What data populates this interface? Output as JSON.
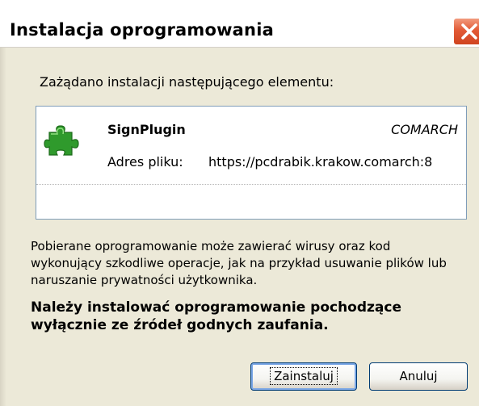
{
  "window": {
    "title": "Instalacja oprogramowania"
  },
  "dialog": {
    "request_text": "Zażądano instalacji następującego elementu:",
    "item": {
      "name": "SignPlugin",
      "vendor": "COMARCH",
      "address_label": "Adres pliku:",
      "address_value": "https://pcdrabik.krakow.comarch:8",
      "icon": "green-puzzle-piece-icon"
    },
    "warning_text": "Pobierane oprogramowanie może zawierać wirusy oraz kod wykonujący szkodliwe operacje, jak na przykład usuwanie plików lub naruszanie prywatności użytkownika.",
    "bold_warning_text": "Należy instalować oprogramowanie pochodzące wyłącznie ze źródeł godnych zaufania.",
    "buttons": {
      "install_label": "Zainstaluj",
      "cancel_label": "Anuluj"
    }
  },
  "colors": {
    "dialog_background": "#ece9d8",
    "close_button": "#e25a36",
    "list_border": "#7f9db9",
    "icon_green": "#2f9a2c"
  }
}
